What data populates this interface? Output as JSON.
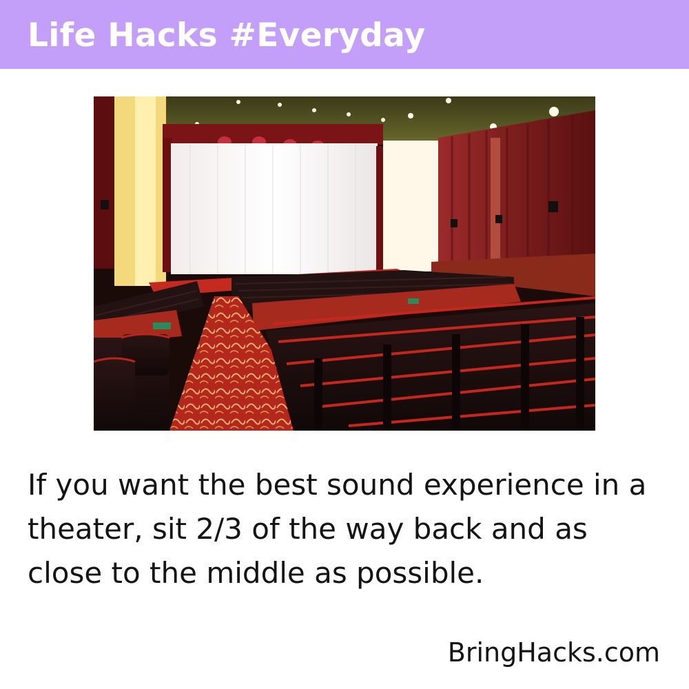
{
  "header": {
    "title": "Life Hacks #Everyday",
    "bg_color": "#c49ff9"
  },
  "photo": {
    "subject": "movie theater auditorium"
  },
  "tip": {
    "text": "If you want the best sound experience in a theater, sit 2/3 of the way back and as close to the middle as possible."
  },
  "footer": {
    "site": "BringHacks.com"
  }
}
